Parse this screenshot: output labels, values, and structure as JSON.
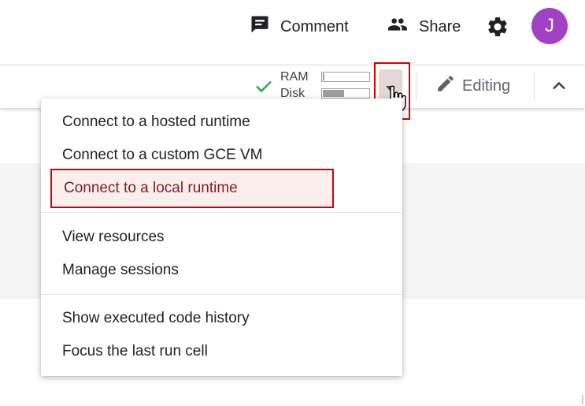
{
  "header": {
    "comment_label": "Comment",
    "share_label": "Share",
    "avatar_initial": "J",
    "avatar_color": "#a142c4"
  },
  "toolbar": {
    "ram_label": "RAM",
    "disk_label": "Disk",
    "ram_usage": 0.03,
    "disk_usage": 0.45,
    "status_color": "#34a853",
    "editing_label": "Editing"
  },
  "runtime_menu": {
    "items": [
      {
        "label": "Connect to a hosted runtime"
      },
      {
        "label": "Connect to a custom GCE VM"
      },
      {
        "label": "Connect to a local runtime",
        "highlighted": true
      },
      {
        "label": "View resources"
      },
      {
        "label": "Manage sessions"
      },
      {
        "label": "Show executed code history"
      },
      {
        "label": "Focus the last run cell"
      }
    ]
  },
  "colors": {
    "highlight_outline": "#d50000",
    "highlight_bg": "#fdeeee"
  }
}
